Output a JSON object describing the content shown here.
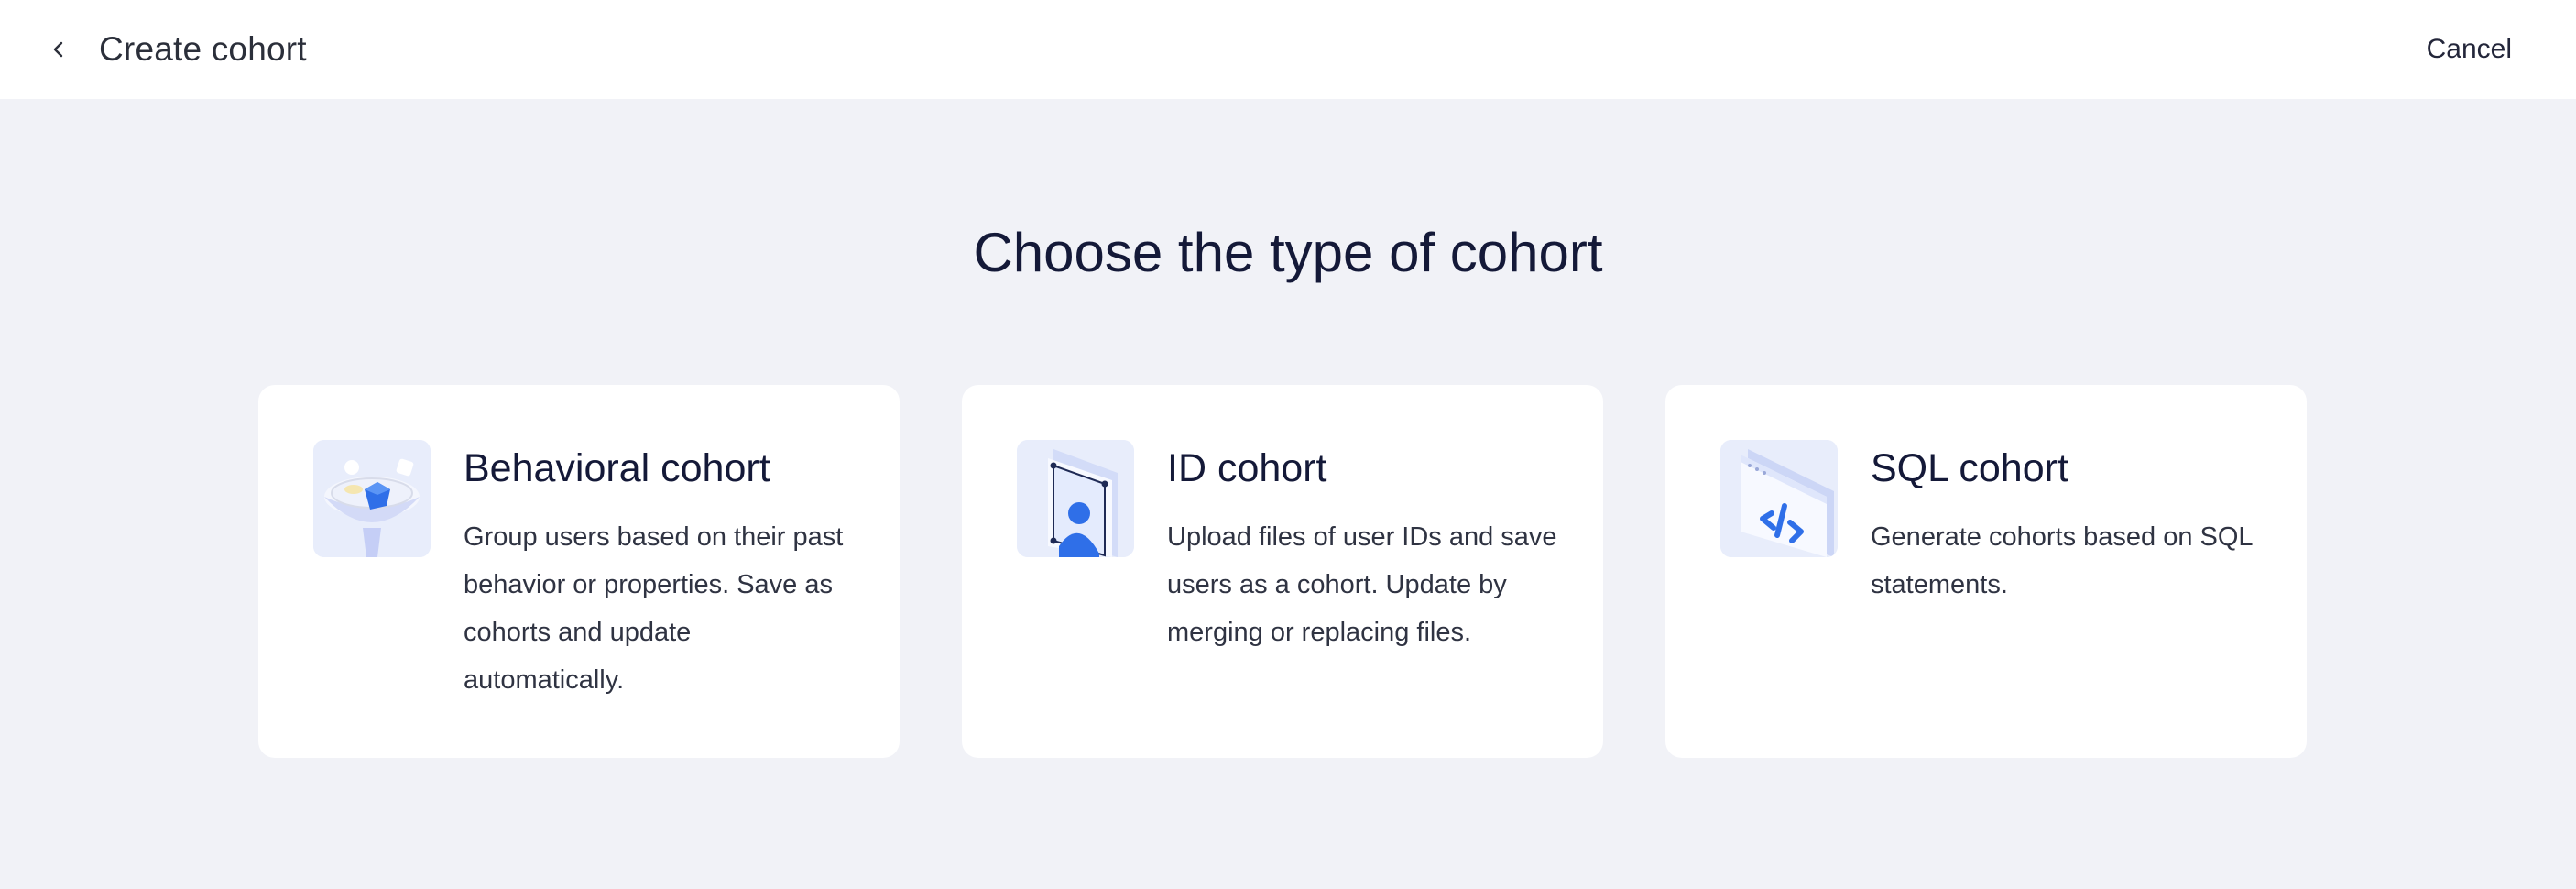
{
  "header": {
    "title": "Create cohort",
    "back_icon": "chevron-left-icon",
    "cancel_label": "Cancel"
  },
  "main": {
    "heading": "Choose the type of cohort",
    "cards": [
      {
        "icon": "funnel-icon",
        "title": "Behavioral cohort",
        "description": "Group users based on their past behavior or properties. Save as cohorts and update automatically."
      },
      {
        "icon": "user-id-card-icon",
        "title": "ID cohort",
        "description": "Upload files of user IDs and save users as a cohort. Update by merging or replacing files."
      },
      {
        "icon": "sql-code-icon",
        "title": "SQL cohort",
        "description": "Generate cohorts based on SQL statements."
      }
    ]
  },
  "colors": {
    "page_background": "#f1f2f7",
    "card_background": "#ffffff",
    "heading_text": "#141938",
    "accent_blue": "#2f6fe8",
    "icon_tile": "#e8edfb"
  }
}
